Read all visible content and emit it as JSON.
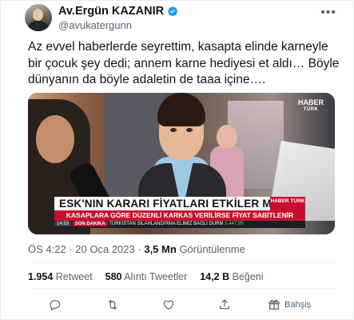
{
  "author": {
    "display_name": "Av.Ergün KAZANIR",
    "handle": "@avukatergunn"
  },
  "tweet": {
    "text": "Az evvel haberlerde seyrettim, kasapta elinde karneyle bir çocuk şey dedi; annem karne hediyesi et aldı… Böyle dünyanın da böyle adaletin de taaa içine…."
  },
  "media": {
    "channel_logo": "HABER",
    "channel_logo_sub": "TÜRK",
    "headline": "ESK'NIN KARARI FİYATLARI ETKİLER Mİ?",
    "headline_logo": "HABER TÜRK",
    "subline": "KASAPLARA GÖRE DÜZENLİ KARKAS VERİLİRSE FİYAT SABİTLENİR",
    "ticker_time": "14:53",
    "ticker_tag": "SON DAKİKA",
    "ticker_text": "TÜRKİSTAN SİLAHLANDIRMA ELİMİZ BAĞLI DURM",
    "ticker_value": "5.447,99"
  },
  "meta": {
    "time": "ÖS 4:22",
    "separator": "·",
    "date": "20 Oca 2023",
    "views_count": "3,5 Mn",
    "views_label": "Görüntülenme"
  },
  "stats": {
    "retweets_count": "1.954",
    "retweets_label": "Retweet",
    "quotes_count": "580",
    "quotes_label": "Alıntı Tweetler",
    "likes_count": "14,2 B",
    "likes_label": "Beğeni"
  },
  "actions": {
    "reply_icon": "reply-icon",
    "retweet_icon": "retweet-icon",
    "like_icon": "heart-icon",
    "share_icon": "share-icon",
    "tip_label": "Bahşiş"
  },
  "colors": {
    "verified": "#1d9bf0",
    "text_secondary": "#536471",
    "news_red": "#c8102e"
  }
}
